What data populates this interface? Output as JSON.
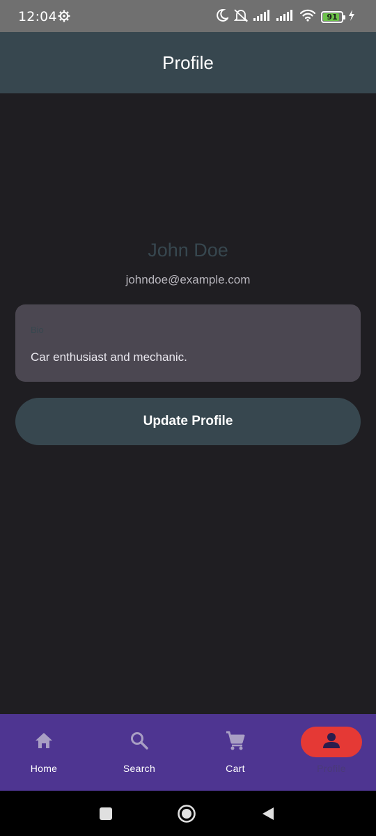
{
  "status_bar": {
    "time": "12:04",
    "battery": "91",
    "battery_level": 0.91,
    "icons": [
      "settings-gear-icon",
      "moon-icon",
      "mute-icon",
      "signal-icon",
      "signal-icon",
      "wifi-icon",
      "battery-icon",
      "charging-icon"
    ]
  },
  "app_bar": {
    "title": "Profile"
  },
  "profile": {
    "name": "John Doe",
    "email": "johndoe@example.com",
    "bio_label": "Bio",
    "bio_value": "Car enthusiast and mechanic."
  },
  "actions": {
    "update_label": "Update Profile"
  },
  "bottom_nav": {
    "items": [
      {
        "label": "Home",
        "icon": "home-icon",
        "active": false
      },
      {
        "label": "Search",
        "icon": "search-icon",
        "active": false
      },
      {
        "label": "Cart",
        "icon": "cart-icon",
        "active": false
      },
      {
        "label": "Profile",
        "icon": "person-icon",
        "active": true
      }
    ]
  },
  "system_nav": {
    "icons": [
      "recents-square-icon",
      "home-circle-icon",
      "back-triangle-icon"
    ]
  },
  "colors": {
    "app_bar": "#37474f",
    "background": "#1f1e22",
    "card": "#4b4751",
    "nav_background": "#4e3591",
    "nav_active": "#e53935"
  }
}
